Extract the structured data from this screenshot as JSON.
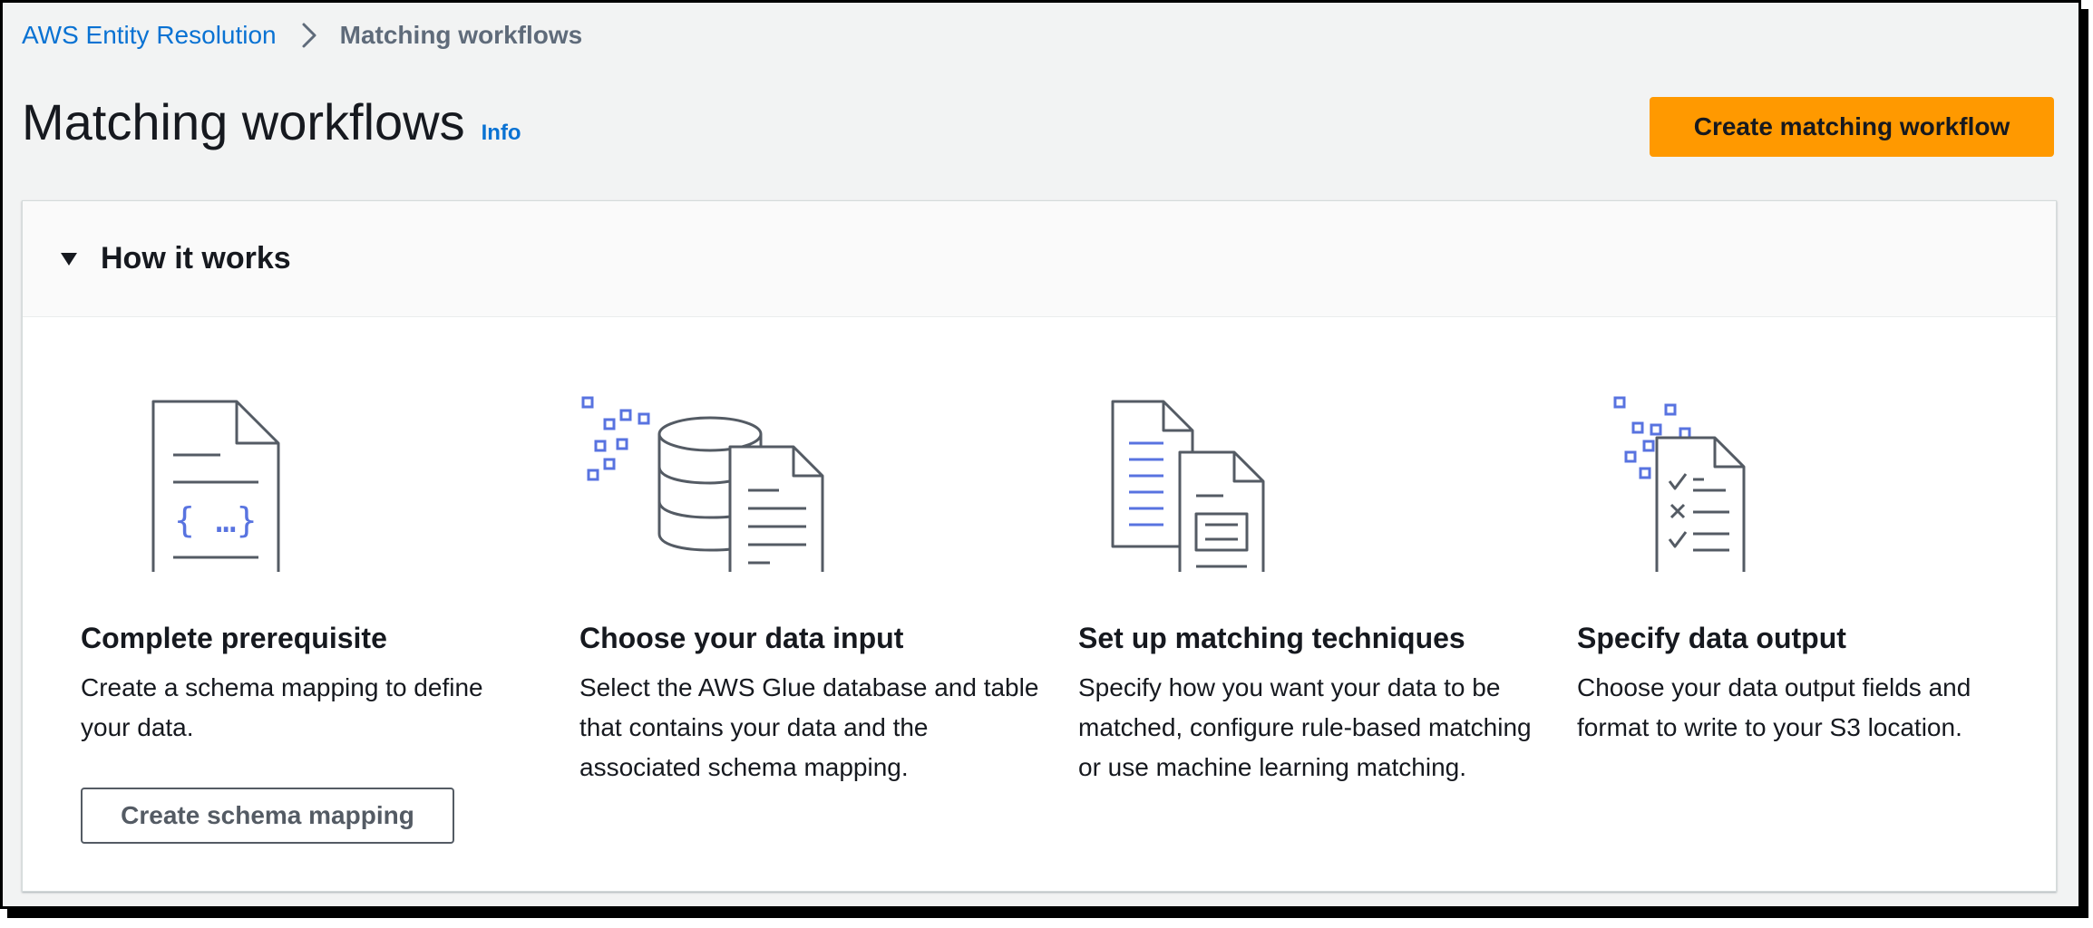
{
  "breadcrumb": {
    "root": "AWS Entity Resolution",
    "current": "Matching workflows"
  },
  "header": {
    "title": "Matching workflows",
    "info": "Info",
    "create_button": "Create matching workflow"
  },
  "how_it_works": {
    "title": "How it works",
    "expanded": true,
    "steps": [
      {
        "icon": "document-schema-icon",
        "title": "Complete prerequisite",
        "description": "Create a schema mapping to define your data.",
        "button": "Create schema mapping"
      },
      {
        "icon": "database-document-icon",
        "title": "Choose your data input",
        "description": "Select the AWS Glue database and table that contains your data and the associated schema mapping."
      },
      {
        "icon": "matching-documents-icon",
        "title": "Set up matching techniques",
        "description": "Specify how you want your data to be matched, configure rule-based matching or use machine learning matching."
      },
      {
        "icon": "checklist-output-icon",
        "title": "Specify data output",
        "description": "Choose your data output fields and format to write to your S3 location."
      }
    ]
  },
  "colors": {
    "primary": "#ff9900",
    "link": "#0972d3",
    "icon_stroke": "#545b64",
    "icon_accent": "#5873e0"
  }
}
